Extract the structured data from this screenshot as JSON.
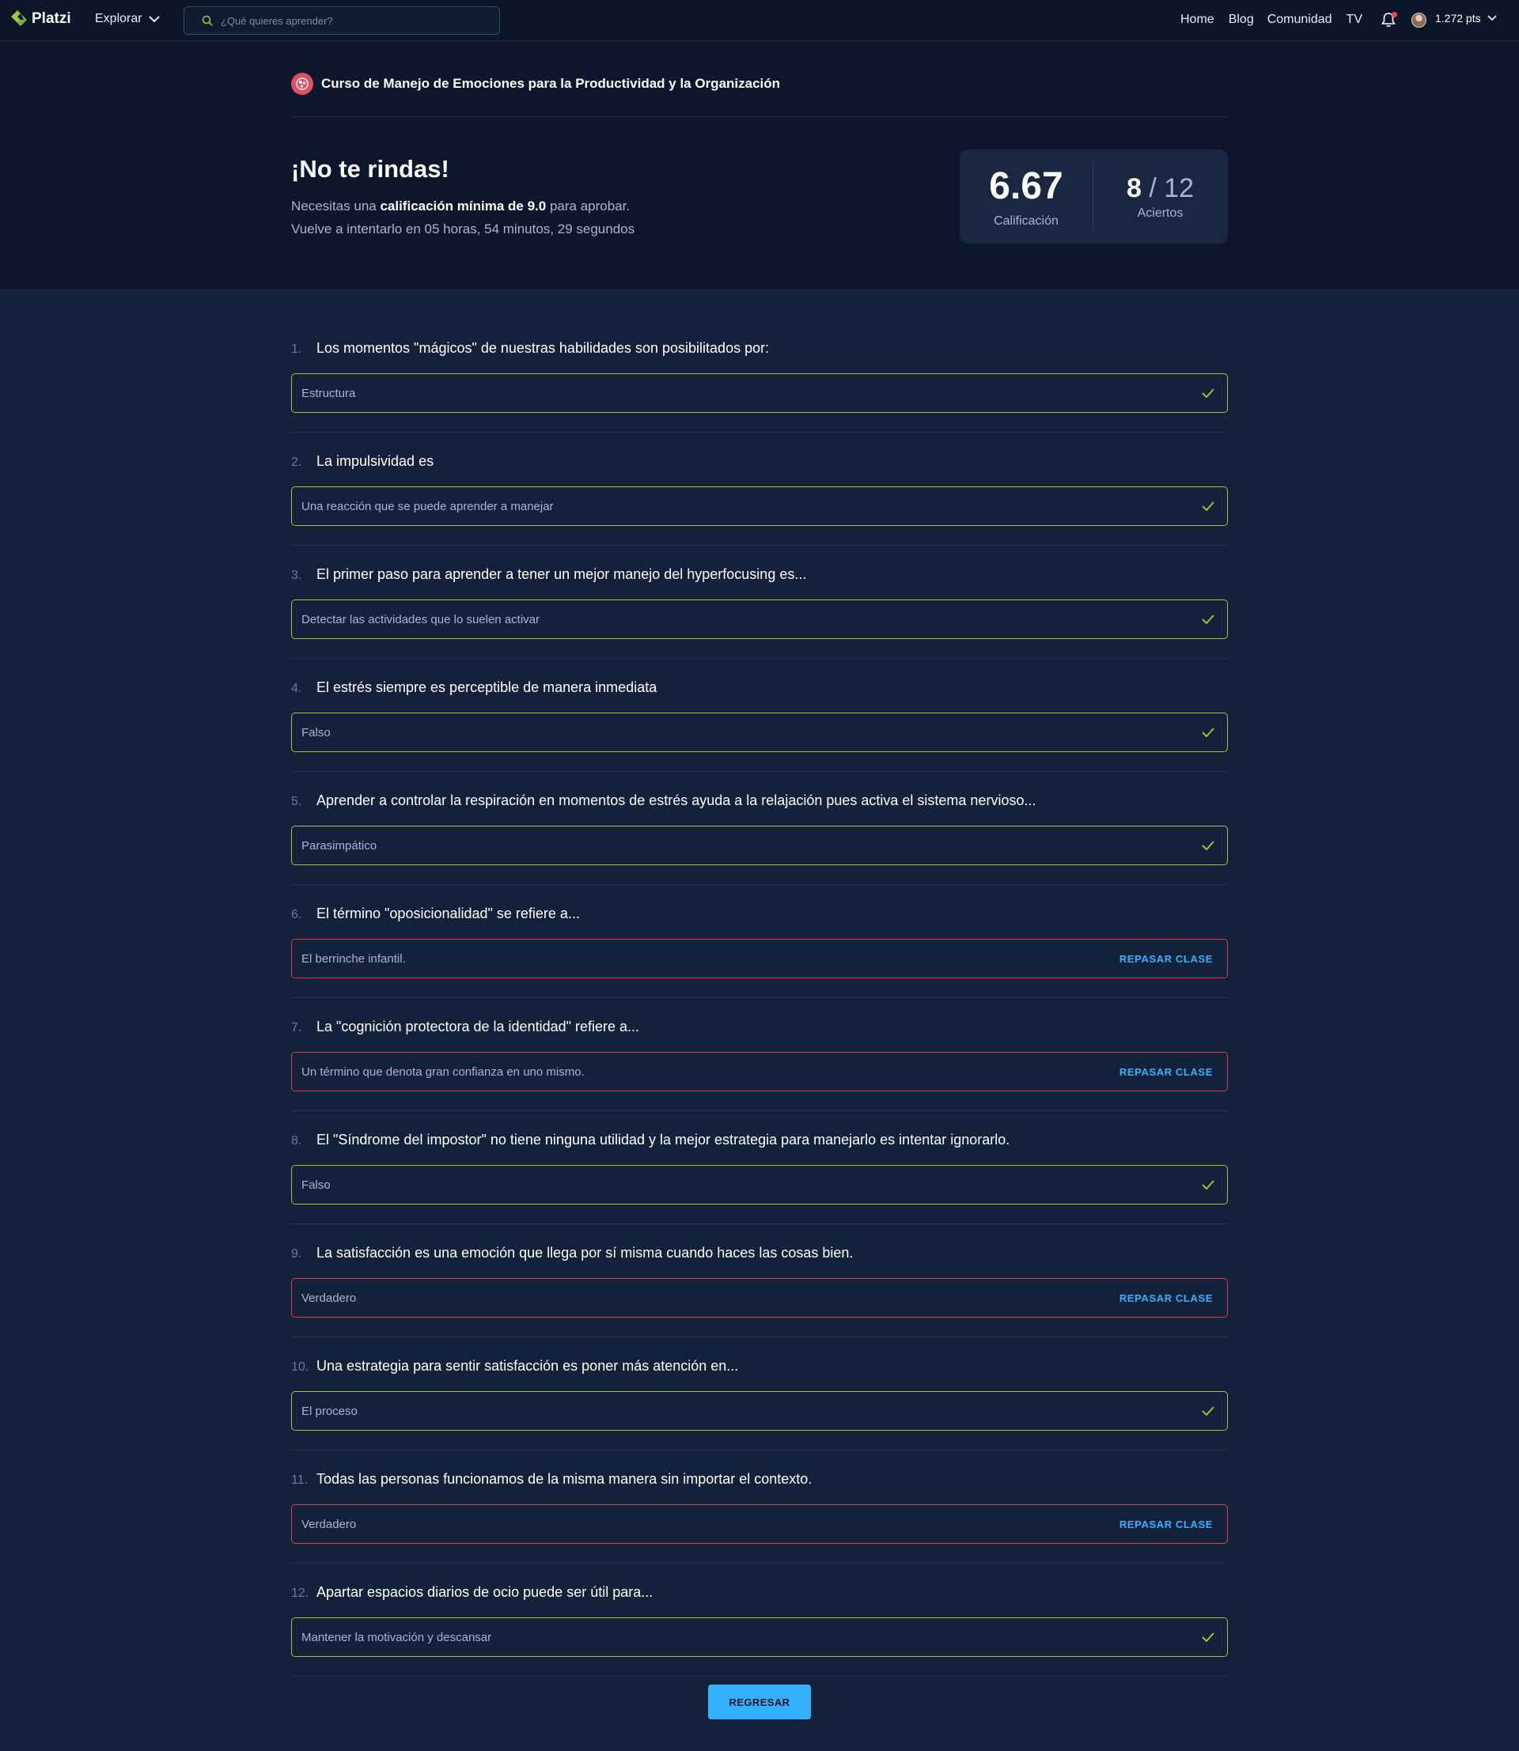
{
  "nav": {
    "brand": "Platzi",
    "explore_label": "Explorar",
    "search_placeholder": "¿Qué quieres aprender?",
    "links": [
      "Home",
      "Blog",
      "Comunidad",
      "TV"
    ],
    "points": "1.272 pts"
  },
  "course": {
    "title": "Curso de Manejo de Emociones para la Productividad y la Organización"
  },
  "result": {
    "headline": "¡No te rindas!",
    "line1_prefix": "Necesitas una ",
    "line1_bold": "calificación mínima de 9.0",
    "line1_suffix": " para aprobar.",
    "line2": "Vuelve a intentarlo en 05 horas, 54 minutos, 29 segundos",
    "grade": "6.67",
    "grade_label": "Calificación",
    "hits_correct": "8",
    "hits_total": " / 12",
    "hits_label": "Aciertos"
  },
  "review_label": "REPASAR CLASE",
  "back_label": "REGRESAR",
  "colors": {
    "correct": "#9fc43a",
    "wrong": "#e03a4e",
    "link": "#33b1ff",
    "background": "#13213b"
  },
  "questions": [
    {
      "num": "1.",
      "text": "Los momentos \"mágicos\" de nuestras habilidades son posibilitados por:",
      "answer": "Estructura",
      "correct": true
    },
    {
      "num": "2.",
      "text": "La impulsividad es",
      "answer": "Una reacción que se puede aprender a manejar",
      "correct": true
    },
    {
      "num": "3.",
      "text": "El primer paso para aprender a tener un mejor manejo del hyperfocusing es...",
      "answer": "Detectar las actividades que lo suelen activar",
      "correct": true
    },
    {
      "num": "4.",
      "text": "El estrés siempre es perceptible de manera inmediata",
      "answer": "Falso",
      "correct": true
    },
    {
      "num": "5.",
      "text": "Aprender a controlar la respiración en momentos de estrés ayuda a la relajación pues activa el sistema nervioso...",
      "answer": "Parasimpático",
      "correct": true
    },
    {
      "num": "6.",
      "text": "El término \"oposicionalidad\" se refiere a...",
      "answer": "El berrinche infantil.",
      "correct": false
    },
    {
      "num": "7.",
      "text": "La \"cognición protectora de la identidad\" refiere a...",
      "answer": "Un término que denota gran confianza en uno mismo.",
      "correct": false
    },
    {
      "num": "8.",
      "text": "El \"Síndrome del impostor\" no tiene ninguna utilidad y la mejor estrategia para manejarlo es intentar ignorarlo.",
      "answer": "Falso",
      "correct": true
    },
    {
      "num": "9.",
      "text": "La satisfacción es una emoción que llega por sí misma cuando haces las cosas bien.",
      "answer": "Verdadero",
      "correct": false
    },
    {
      "num": "10.",
      "text": "Una estrategia para sentir satisfacción es poner más atención en...",
      "answer": "El proceso",
      "correct": true
    },
    {
      "num": "11.",
      "text": "Todas las personas funcionamos de la misma manera sin importar el contexto.",
      "answer": "Verdadero",
      "correct": false
    },
    {
      "num": "12.",
      "text": "Apartar espacios diarios de ocio puede ser útil para...",
      "answer": "Mantener la motivación y descansar",
      "correct": true
    }
  ]
}
